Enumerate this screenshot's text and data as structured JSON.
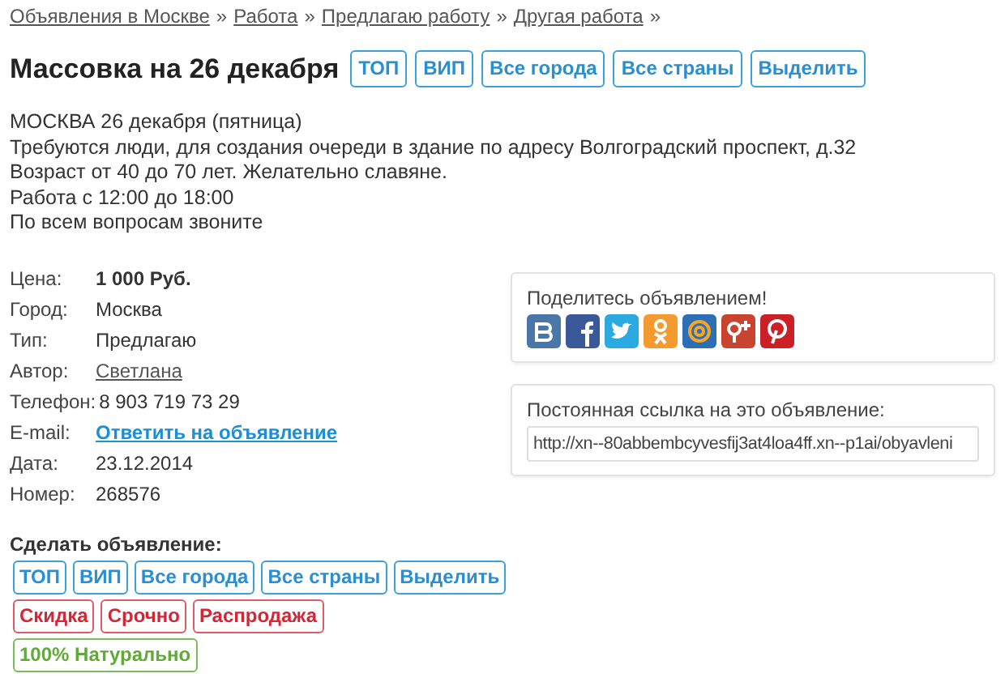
{
  "breadcrumbs": [
    {
      "label": "Объявления в Москве"
    },
    {
      "label": "Работа"
    },
    {
      "label": "Предлагаю работу"
    },
    {
      "label": "Другая работа"
    }
  ],
  "breadcrumb_separator": "»",
  "title": "Массовка на 26 декабря",
  "title_tags": [
    {
      "label": "ТОП",
      "kind": "blue"
    },
    {
      "label": "ВИП",
      "kind": "blue"
    },
    {
      "label": "Все города",
      "kind": "blue"
    },
    {
      "label": "Все страны",
      "kind": "blue"
    },
    {
      "label": "Выделить",
      "kind": "blue"
    }
  ],
  "description": [
    "МОСКВА 26 декабря (пятница)",
    "Требуются люди, для создания очереди в здание по адресу Волгоградский проспект, д.32",
    "Возраст от 40 до 70 лет. Желательно славяне.",
    "Работа с 12:00 до 18:00",
    "По всем вопросам звоните"
  ],
  "fields": [
    {
      "label": "Цена:",
      "value": "1 000 Руб.",
      "kind": "bold"
    },
    {
      "label": "Город:",
      "value": "Москва",
      "kind": "text"
    },
    {
      "label": "Тип:",
      "value": "Предлагаю",
      "kind": "text"
    },
    {
      "label": "Автор:",
      "value": "Светлана",
      "kind": "link"
    },
    {
      "label": "Телефон:",
      "value": "8 903 719 73 29",
      "kind": "text"
    },
    {
      "label": "E-mail:",
      "value": "Ответить на объявление",
      "kind": "action"
    },
    {
      "label": "Дата:",
      "value": "23.12.2014",
      "kind": "text"
    },
    {
      "label": "Номер:",
      "value": "268576",
      "kind": "text"
    }
  ],
  "share": {
    "title": "Поделитесь объявлением!",
    "networks": [
      {
        "kind": "vk",
        "color": "#4a76a8"
      },
      {
        "kind": "facebook",
        "color": "#3b5998"
      },
      {
        "kind": "twitter",
        "color": "#2ba9e1"
      },
      {
        "kind": "odnoklassniki",
        "color": "#f59a2f"
      },
      {
        "kind": "mail",
        "color": "#2d6fb7"
      },
      {
        "kind": "gplus",
        "color": "#c8442e"
      },
      {
        "kind": "pinterest",
        "color": "#cb2027"
      }
    ]
  },
  "permalink": {
    "label": "Постоянная ссылка на это объявление:",
    "value": "http://xn--80abbembcyvesfij3at4loa4ff.xn--p1ai/obyavleni"
  },
  "promote": {
    "title": "Сделать объявление:",
    "rows": [
      [
        {
          "label": "ТОП",
          "kind": "blue"
        },
        {
          "label": "ВИП",
          "kind": "blue"
        },
        {
          "label": "Все города",
          "kind": "blue"
        },
        {
          "label": "Все страны",
          "kind": "blue"
        },
        {
          "label": "Выделить",
          "kind": "blue"
        }
      ],
      [
        {
          "label": "Скидка",
          "kind": "red"
        },
        {
          "label": "Срочно",
          "kind": "red"
        },
        {
          "label": "Распродажа",
          "kind": "red"
        }
      ],
      [
        {
          "label": "100% Натурально",
          "kind": "green"
        }
      ]
    ]
  }
}
